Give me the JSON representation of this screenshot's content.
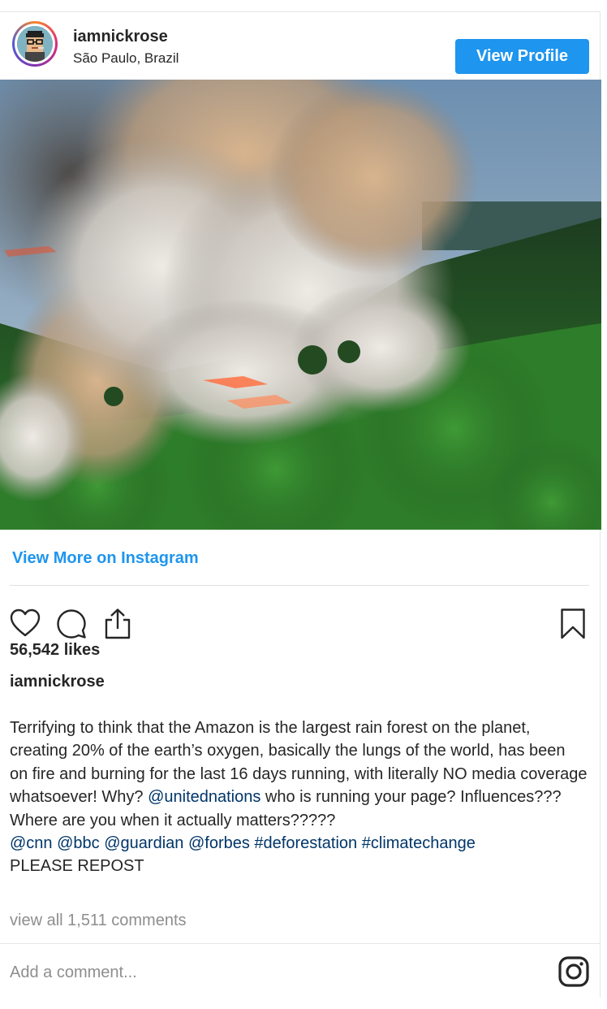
{
  "header": {
    "username": "iamnickrose",
    "location": "São Paulo, Brazil",
    "view_profile_label": "View Profile"
  },
  "post": {
    "view_more_label": "View More on Instagram",
    "likes": "56,542 likes",
    "caption_user": "iamnickrose",
    "caption_text_1": "Terrifying to think that the Amazon is the largest rain forest on the planet, creating 20% of the earth’s oxygen, basically the lungs of the world, has been on fire and burning for the last 16 days running, with literally NO media coverage whatsoever! Why? ",
    "mention_un": "@unitednations",
    "caption_text_2": " who is running your page? Influences??? Where are you when it actually matters?????",
    "tags": [
      "@cnn",
      "@bbc",
      "@guardian",
      "@forbes",
      "#deforestation",
      "#climatechange"
    ],
    "caption_text_3": "PLEASE REPOST",
    "comments_label": "view all 1,511 comments",
    "add_comment_placeholder": "Add a comment..."
  },
  "icons": {
    "like": "heart-icon",
    "comment": "comment-icon",
    "share": "share-icon",
    "save": "bookmark-icon",
    "brand": "instagram-icon"
  },
  "colors": {
    "accent": "#1e95ee",
    "link": "#003569",
    "muted": "#8e8e8e"
  }
}
